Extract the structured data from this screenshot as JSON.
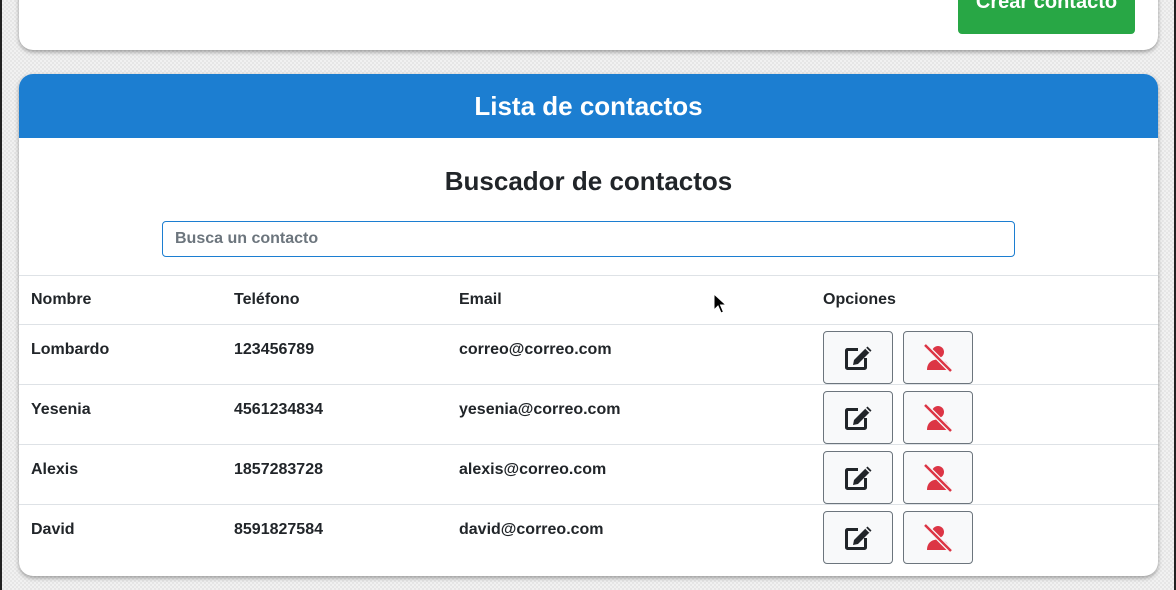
{
  "header": {
    "create_label": "Crear contacto"
  },
  "list": {
    "title": "Lista de contactos",
    "search_title": "Buscador de contactos",
    "search_placeholder": "Busca un contacto",
    "search_value": "",
    "columns": [
      "Nombre",
      "Teléfono",
      "Email",
      "Opciones"
    ],
    "rows": [
      {
        "name": "Lombardo",
        "phone": "123456789",
        "email": "correo@correo.com"
      },
      {
        "name": "Yesenia",
        "phone": "4561234834",
        "email": "yesenia@correo.com"
      },
      {
        "name": "Alexis",
        "phone": "1857283728",
        "email": "alexis@correo.com"
      },
      {
        "name": "David",
        "phone": "8591827584",
        "email": "david@correo.com"
      }
    ],
    "row_actions": {
      "edit_icon": "edit-icon",
      "delete_icon": "user-slash-icon"
    }
  },
  "colors": {
    "header_blue": "#1c7ed1",
    "create_green": "#28a745",
    "delete_red": "#dc3545",
    "text_dark": "#212529"
  }
}
